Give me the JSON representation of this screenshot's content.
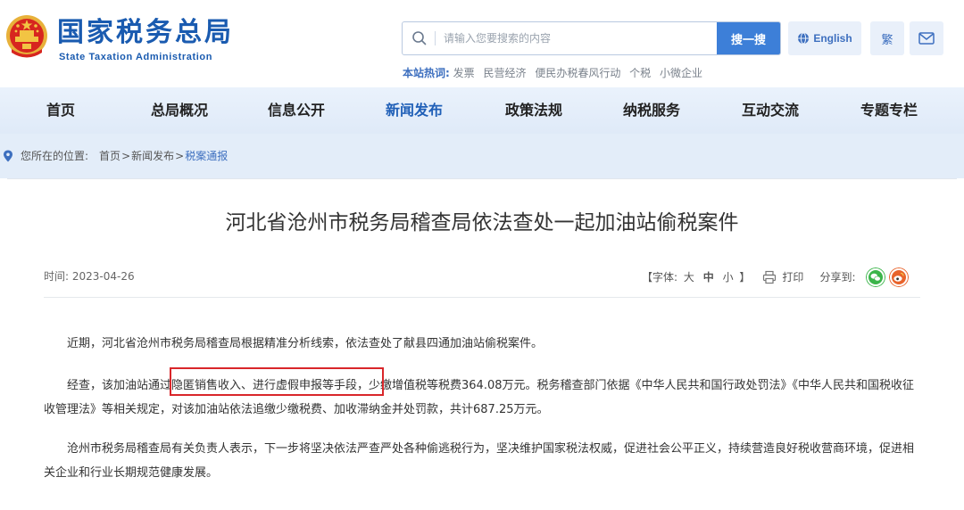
{
  "brand": {
    "name_cn": "国家税务总局",
    "name_en": "State Taxation Administration"
  },
  "search": {
    "placeholder": "请输入您要搜索的内容",
    "button_label": "搜一搜"
  },
  "hot": {
    "label": "本站热词:",
    "items": [
      "发票",
      "民营经济",
      "便民办税春风行动",
      "个税",
      "小微企业"
    ]
  },
  "top_buttons": {
    "english": "English",
    "traditional": "繁"
  },
  "nav": {
    "items": [
      "首页",
      "总局概况",
      "信息公开",
      "新闻发布",
      "政策法规",
      "纳税服务",
      "互动交流",
      "专题专栏"
    ],
    "active_index": 3
  },
  "breadcrumb": {
    "label": "您所在的位置:",
    "home": "首页",
    "sep": ">",
    "section": "新闻发布",
    "current": "税案通报"
  },
  "article": {
    "title": "河北省沧州市税务局稽查局依法查处一起加油站偷税案件",
    "date": "时间: 2023-04-26",
    "font_size": {
      "open": "【字体:",
      "large": "大",
      "medium": "中",
      "small": "小",
      "close": "】"
    },
    "print": "打印",
    "share": "分享到:",
    "paragraphs": [
      "近期，河北省沧州市税务局稽查局根据精准分析线索，依法查处了献县四通加油站偷税案件。",
      "经查，该加油站通过隐匿销售收入、进行虚假申报等手段，少缴增值税等税费364.08万元。税务稽查部门依据《中华人民共和国行政处罚法》《中华人民共和国税收征收管理法》等相关规定，对该加油站依法追缴少缴税费、加收滞纳金并处罚款，共计687.25万元。",
      "沧州市税务局稽查局有关负责人表示，下一步将坚决依法严查严处各种偷逃税行为，坚决维护国家税法权威，促进社会公平正义，持续营造良好税收营商环境，促进相关企业和行业长期规范健康发展。"
    ]
  },
  "colors": {
    "brand_blue": "#1a5bb0",
    "accent_blue": "#3d7fd8",
    "highlight_red": "#d9262a",
    "wechat_green": "#3bb54a",
    "weibo_orange": "#e8632b"
  }
}
